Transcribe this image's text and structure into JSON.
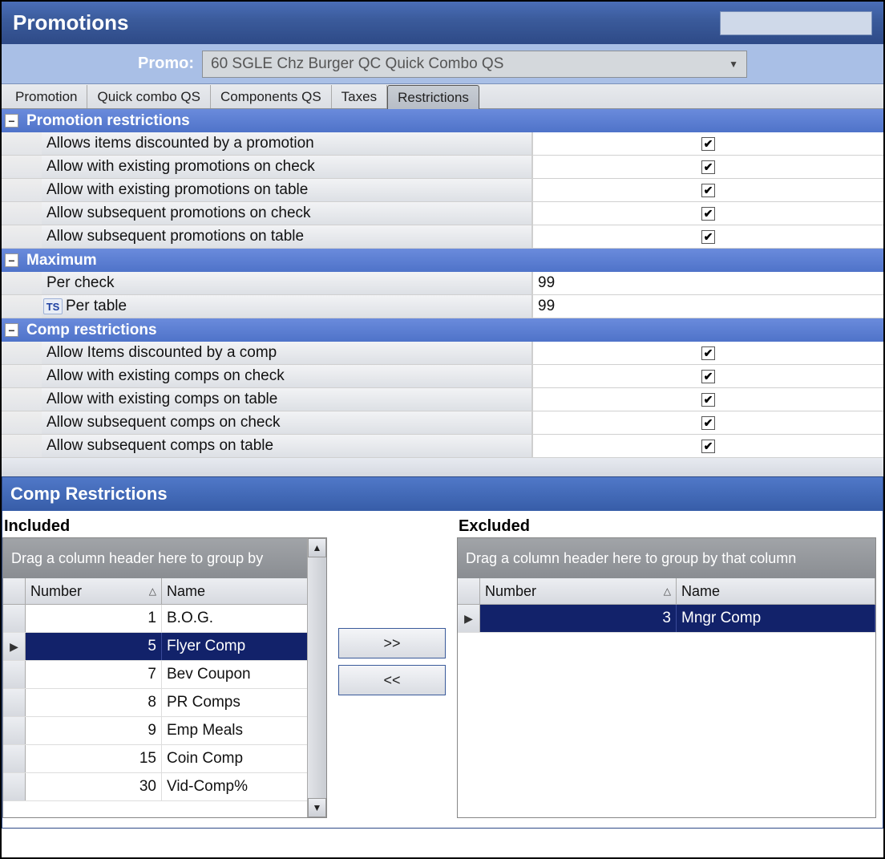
{
  "title": "Promotions",
  "promo_label": "Promo:",
  "promo_selected": "60 SGLE Chz Burger QC Quick Combo QS",
  "tabs": [
    {
      "label": "Promotion",
      "active": false
    },
    {
      "label": "Quick combo QS",
      "active": false
    },
    {
      "label": "Components QS",
      "active": false
    },
    {
      "label": "Taxes",
      "active": false
    },
    {
      "label": "Restrictions",
      "active": true
    }
  ],
  "sections": {
    "promotion_restrictions": {
      "title": "Promotion restrictions",
      "rows": [
        {
          "label": "Allows items discounted by a promotion",
          "checked": true
        },
        {
          "label": "Allow with existing promotions on check",
          "checked": true
        },
        {
          "label": "Allow with existing promotions on table",
          "checked": true
        },
        {
          "label": "Allow subsequent promotions on check",
          "checked": true
        },
        {
          "label": "Allow subsequent promotions on table",
          "checked": true
        }
      ]
    },
    "maximum": {
      "title": "Maximum",
      "rows": [
        {
          "label": "Per check",
          "value": "99",
          "ts": false
        },
        {
          "label": "Per table",
          "value": "99",
          "ts": true
        }
      ]
    },
    "comp_restrictions": {
      "title": "Comp restrictions",
      "rows": [
        {
          "label": "Allow Items discounted by a comp",
          "checked": true
        },
        {
          "label": "Allow with existing comps on check",
          "checked": true
        },
        {
          "label": "Allow with existing comps on table",
          "checked": true
        },
        {
          "label": "Allow subsequent comps on check",
          "checked": true
        },
        {
          "label": "Allow subsequent comps on table",
          "checked": true
        }
      ]
    }
  },
  "panel": {
    "title": "Comp Restrictions",
    "included_label": "Included",
    "excluded_label": "Excluded",
    "group_hint_short": "Drag a column header here to group by",
    "group_hint_long": "Drag a column header here to group by that column",
    "col_number": "Number",
    "col_name": "Name",
    "move_right": ">>",
    "move_left": "<<",
    "included": [
      {
        "number": 1,
        "name": "B.O.G.",
        "selected": false
      },
      {
        "number": 5,
        "name": "Flyer Comp",
        "selected": true
      },
      {
        "number": 7,
        "name": "Bev Coupon",
        "selected": false
      },
      {
        "number": 8,
        "name": "PR Comps",
        "selected": false
      },
      {
        "number": 9,
        "name": "Emp Meals",
        "selected": false
      },
      {
        "number": 15,
        "name": "Coin Comp",
        "selected": false
      },
      {
        "number": 30,
        "name": "Vid-Comp%",
        "selected": false
      }
    ],
    "excluded": [
      {
        "number": 3,
        "name": "Mngr Comp",
        "selected": true
      }
    ]
  }
}
